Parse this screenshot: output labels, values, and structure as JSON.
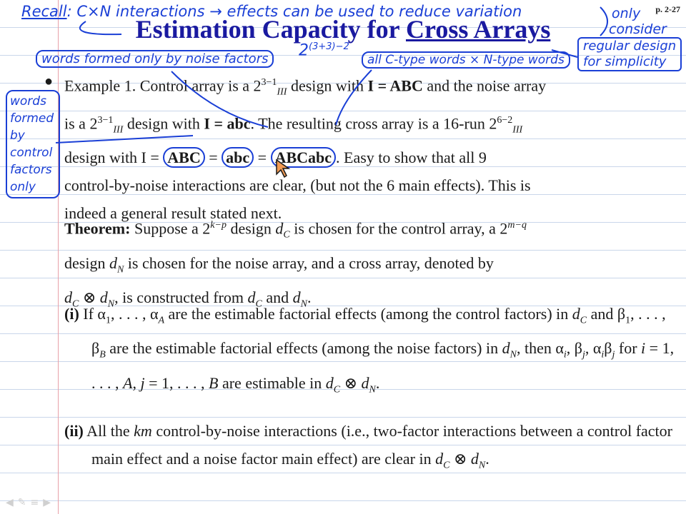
{
  "page_number": "p. 2-27",
  "title": {
    "part1": "Estimation Capacity for ",
    "part2": "Cross Arrays"
  },
  "example": {
    "line1_a": "Example 1. Control array is a 2",
    "line1_exp": "3−1",
    "line1_sub": "III",
    "line1_b": " design with ",
    "line1_eq": "I = ABC",
    "line1_c": " and the noise array",
    "line2_a": "is a 2",
    "line2_exp": "3−1",
    "line2_sub": "III",
    "line2_b": " design with ",
    "line2_eq": "I = abc",
    "line2_c": ". The resulting cross array is a 16-run 2",
    "line2_exp2": "6−2",
    "line2_sub2": "III",
    "line3_a": "design with I = ",
    "w1": "ABC",
    "eq": " = ",
    "w2": "abc",
    "w3": "ABCabc",
    "line3_b": ". Easy to show that all 9",
    "line4": "control-by-noise interactions are clear, (but not the 6 main effects). This is",
    "line5": "indeed a general result stated next."
  },
  "theorem": {
    "label": "Theorem:",
    "t1": " Suppose a 2",
    "t1_exp": "k−p",
    "t1b": " design ",
    "dc": "d",
    "dc_sub": "C",
    "t1c": " is chosen for the control array, a 2",
    "t1_exp2": "m−q",
    "t2a": "design ",
    "dn_sub": "N",
    "t2b": " is chosen for the noise array, and a cross array, denoted by",
    "t3b": ", is constructed from ",
    "t3c": " and ",
    "t3d": ".",
    "otimes": " ⊗ "
  },
  "item_i": {
    "label": "(i)",
    "a1": " If α",
    "a1s": "1",
    "a2": ", . . . , α",
    "a2s": "A",
    "a3": " are the estimable factorial effects (among the control",
    "b1": "factors) in ",
    "b2": " and β",
    "b2s": "1",
    "b3": ", . . . , β",
    "b3s": "B",
    "b4": " are the estimable factorial effects (among",
    "c1": "the noise factors) in ",
    "c2": ", then α",
    "ci": "i",
    "c3": ", β",
    "cj": "j",
    "c4": ", α",
    "c5": "β",
    "c6": " for ",
    "c7": "i",
    "c8": " = 1, . . . , ",
    "c9": "A",
    "c10": ",  ",
    "c11": "j",
    "c12": " = 1, . . . , ",
    "c13": "B",
    "c14": " are",
    "d1": "estimable in ",
    "d2": "."
  },
  "item_ii": {
    "label": "(ii)",
    "a1": "  All the ",
    "km": "km",
    "a2": " control-by-noise interactions (i.e., two-factor interactions",
    "b": "between a control factor main effect and a noise factor main effect) are",
    "c1": "clear in ",
    "c2": "."
  },
  "annotations": {
    "recall": "Recall",
    "recall_text": ": C×N interactions → effects can be used to reduce variation",
    "only": "only",
    "consider": "consider",
    "regular": "regular design",
    "simplicity": "for simplicity",
    "noise_words": "words formed only by noise factors",
    "power": "2",
    "power_exp": "(3+3)−2",
    "ctype": "all C-type words × N-type words",
    "control_words": [
      "words",
      "formed",
      "by control",
      "factors",
      "only"
    ]
  },
  "ink_color": "#1a3fd6",
  "title_color": "#1a1aa0",
  "nav_icons": [
    "left-arrow",
    "pen",
    "menu",
    "right-arrow"
  ]
}
